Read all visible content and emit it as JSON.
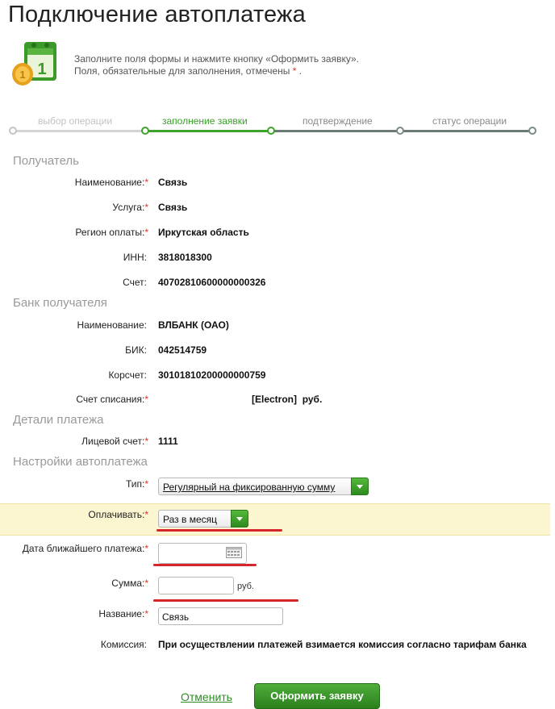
{
  "page": {
    "title": "Подключение автоплатежа",
    "hint_line1": "Заполните поля формы и нажмите кнопку «Оформить заявку».",
    "hint_line2": "Поля, обязательные для заполнения, отмечены",
    "hint_required_mark": "*",
    "hint_line2_end": "."
  },
  "stepper": {
    "steps": [
      {
        "label": "выбор операции",
        "state": "done"
      },
      {
        "label": "заполнение заявки",
        "state": "active"
      },
      {
        "label": "подтверждение",
        "state": "pending"
      },
      {
        "label": "статус операции",
        "state": "pending"
      }
    ]
  },
  "required_mark": "*",
  "recipient": {
    "section_title": "Получатель",
    "name_label": "Наименование:",
    "name_value": "Связь",
    "service_label": "Услуга:",
    "service_value": "Связь",
    "region_label": "Регион оплаты:",
    "region_value": "Иркутская область",
    "inn_label": "ИНН:",
    "inn_value": "3818018300",
    "account_label": "Счет:",
    "account_value": "40702810600000000326"
  },
  "bank": {
    "section_title": "Банк получателя",
    "name_label": "Наименование:",
    "name_value": "ВЛБАНК (ОАО)",
    "bik_label": "БИК:",
    "bik_value": "042514759",
    "corr_label": "Корсчет:",
    "corr_value": "30101810200000000759",
    "debit_label": "Счет списания:",
    "debit_card": "[Electron]",
    "debit_currency": "руб."
  },
  "details": {
    "section_title": "Детали платежа",
    "personal_account_label": "Лицевой счет:",
    "personal_account_value": "1111"
  },
  "settings": {
    "section_title": "Настройки автоплатежа",
    "type_label": "Тип:",
    "type_value": "Регулярный на фиксированную сумму",
    "pay_label": "Оплачивать:",
    "pay_value": "Раз в месяц",
    "date_label": "Дата ближайшего платежа:",
    "date_value": "",
    "sum_label": "Сумма:",
    "sum_value": "",
    "sum_unit": "руб.",
    "title_label": "Название:",
    "title_value": "Связь",
    "commission_label": "Комиссия:",
    "commission_value": "При осуществлении платежей взимается комиссия согласно тарифам банка"
  },
  "actions": {
    "cancel_label": "Отменить",
    "submit_label": "Оформить заявку"
  },
  "colors": {
    "accent_green": "#38a028",
    "required_red": "#e0302a",
    "highlight": "#fbf6d0"
  }
}
